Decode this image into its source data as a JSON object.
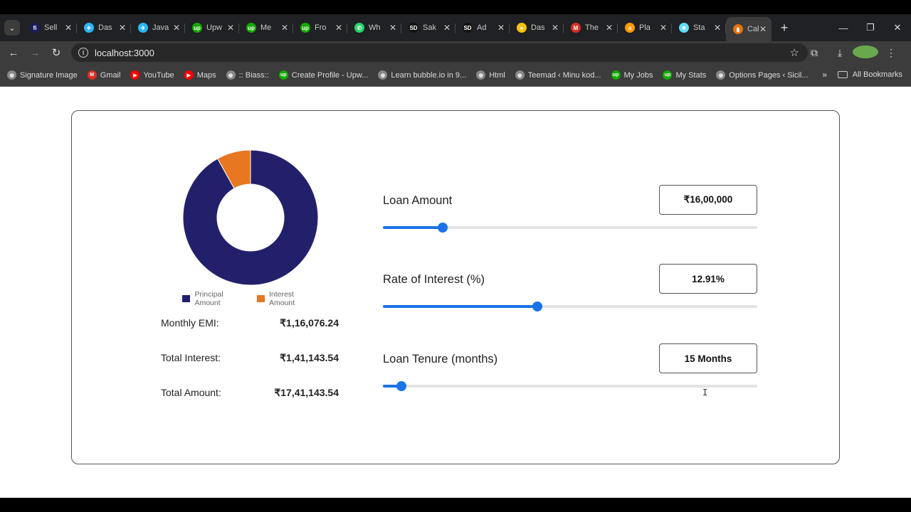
{
  "browser": {
    "tabs": [
      {
        "label": "Sell",
        "icon": "freelancer-icon",
        "color": "#1b1b5e",
        "glyph": "fi"
      },
      {
        "label": "Das",
        "icon": "vector-icon",
        "color": "#29b6f6",
        "glyph": "✈"
      },
      {
        "label": "Java",
        "icon": "vector-icon",
        "color": "#29b6f6",
        "glyph": "✈"
      },
      {
        "label": "Upw",
        "icon": "upwork-icon",
        "color": "#14a800",
        "glyph": "up"
      },
      {
        "label": "Me",
        "icon": "upwork-icon",
        "color": "#14a800",
        "glyph": "up"
      },
      {
        "label": "Fro",
        "icon": "upwork-icon",
        "color": "#14a800",
        "glyph": "up"
      },
      {
        "label": "Wh",
        "icon": "whatsapp-icon",
        "color": "#25d366",
        "glyph": "✆"
      },
      {
        "label": "Sak",
        "icon": "sd-icon",
        "color": "#111111",
        "glyph": "SD"
      },
      {
        "label": "Ad",
        "icon": "sd-icon",
        "color": "#111111",
        "glyph": "SD"
      },
      {
        "label": "Das",
        "icon": "yellow-icon",
        "color": "#f4c20d",
        "glyph": "●"
      },
      {
        "label": "The",
        "icon": "gmail-icon",
        "color": "#d93025",
        "glyph": "M"
      },
      {
        "label": "Pla",
        "icon": "amazon-icon",
        "color": "#ff9900",
        "glyph": "a"
      },
      {
        "label": "Sta",
        "icon": "react-icon",
        "color": "#61dafb",
        "glyph": "⚛"
      }
    ],
    "active_tab": {
      "label": "Cal",
      "icon": "react-icon",
      "color": "#e8710a",
      "glyph": "▮"
    },
    "url": "localhost:3000",
    "bookmarks": [
      {
        "label": "Signature Image",
        "icon": "globe-icon",
        "color": "#888888",
        "glyph": "◍"
      },
      {
        "label": "Gmail",
        "icon": "gmail-icon",
        "color": "#d93025",
        "glyph": "M"
      },
      {
        "label": "YouTube",
        "icon": "youtube-icon",
        "color": "#ff0000",
        "glyph": "▶"
      },
      {
        "label": "Maps",
        "icon": "youtube-icon",
        "color": "#ff0000",
        "glyph": "▶"
      },
      {
        "label": ":: Biass::",
        "icon": "globe-icon",
        "color": "#888888",
        "glyph": "◍"
      },
      {
        "label": "Create Profile - Upw...",
        "icon": "upwork-icon",
        "color": "#14a800",
        "glyph": "up"
      },
      {
        "label": "Learn bubble.io in 9...",
        "icon": "globe-icon",
        "color": "#888888",
        "glyph": "◍"
      },
      {
        "label": "Html",
        "icon": "globe-icon",
        "color": "#888888",
        "glyph": "◍"
      },
      {
        "label": "Teemad ‹ Minu kod...",
        "icon": "globe-icon",
        "color": "#888888",
        "glyph": "◍"
      },
      {
        "label": "My Jobs",
        "icon": "upwork-icon",
        "color": "#14a800",
        "glyph": "up"
      },
      {
        "label": "My Stats",
        "icon": "upwork-icon",
        "color": "#14a800",
        "glyph": "up"
      },
      {
        "label": "Options Pages ‹ Sicil...",
        "icon": "globe-icon",
        "color": "#888888",
        "glyph": "◍"
      }
    ],
    "all_bookmarks": "All Bookmarks"
  },
  "calculator": {
    "legend": {
      "principal": "Principal Amount",
      "interest": "Interest Amount"
    },
    "colors": {
      "principal": "#23206b",
      "interest": "#e87722",
      "accent": "#1a73e8"
    },
    "pie": {
      "principal": 1600000,
      "interest": 141143.54
    },
    "summary": [
      {
        "label": "Monthly EMI:",
        "value": "₹1,16,076.24"
      },
      {
        "label": "Total Interest:",
        "value": "₹1,41,143.54"
      },
      {
        "label": "Total Amount:",
        "value": "₹17,41,143.54"
      }
    ],
    "fields": [
      {
        "label": "Loan Amount",
        "value": "₹16,00,000",
        "slider_fraction": 0.16
      },
      {
        "label": "Rate of Interest (%)",
        "value": "12.91%",
        "slider_fraction": 0.413
      },
      {
        "label": "Loan Tenure (months)",
        "value": "15 Months",
        "slider_fraction": 0.05
      }
    ]
  }
}
